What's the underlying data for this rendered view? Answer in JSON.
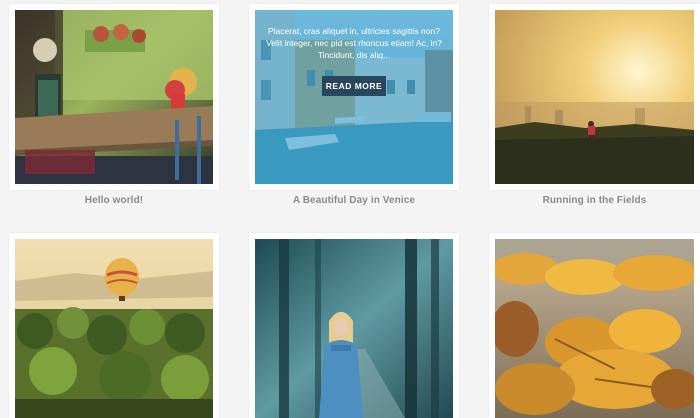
{
  "gallery": {
    "posts": [
      {
        "title": "Hello world!",
        "image": "cafe-table-photo"
      },
      {
        "title": "A Beautiful Day in Venice",
        "image": "venice-canal-photo",
        "hover_excerpt": "Placerat, cras aliquet in, ultricies sagittis non? Velit integer, nec pid est rhoncus etiam! Ac, in? Tincidunt, dis aliq...",
        "read_more_label": "READ MORE"
      },
      {
        "title": "Running in the Fields",
        "image": "runner-sunset-photo"
      },
      {
        "title": "",
        "image": "hot-air-balloon-palms-photo"
      },
      {
        "title": "",
        "image": "girl-forest-photo"
      },
      {
        "title": "",
        "image": "autumn-leaves-photo"
      }
    ]
  },
  "colors": {
    "page_bg": "#f4f4f4",
    "card_bg": "#ffffff",
    "caption": "#8a8a8a",
    "overlay": "#36a0d2",
    "read_more_bg": "#28465c"
  }
}
